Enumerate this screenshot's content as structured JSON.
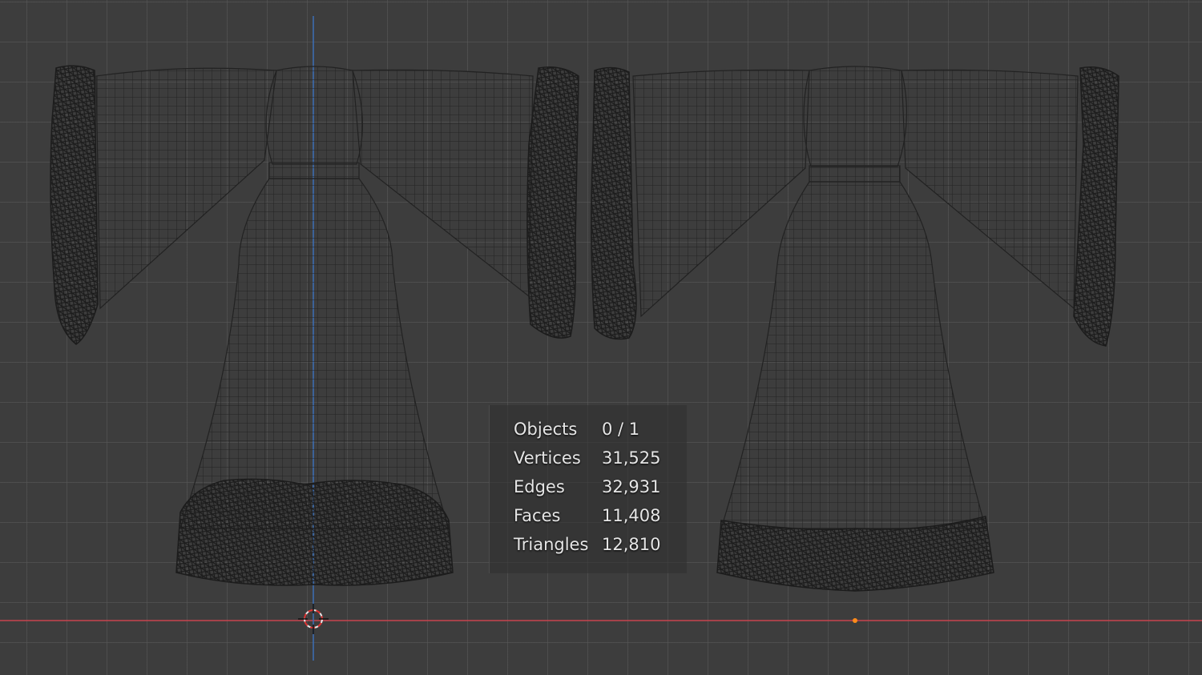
{
  "viewport": {
    "background": "#3d3d3d",
    "grid_color": "#5a5a5a",
    "x_axis_color": "#c8454f",
    "z_axis_color": "#3c6fb6",
    "wire_color": "#1f1f1f",
    "origin_color": "#ff8c1a",
    "cursor_icon": "3d-cursor-icon"
  },
  "stats": {
    "rows": [
      {
        "label": "Objects",
        "value": "0 / 1"
      },
      {
        "label": "Vertices",
        "value": "31,525"
      },
      {
        "label": "Edges",
        "value": "32,931"
      },
      {
        "label": "Faces",
        "value": "11,408"
      },
      {
        "label": "Triangles",
        "value": "12,810"
      }
    ]
  }
}
